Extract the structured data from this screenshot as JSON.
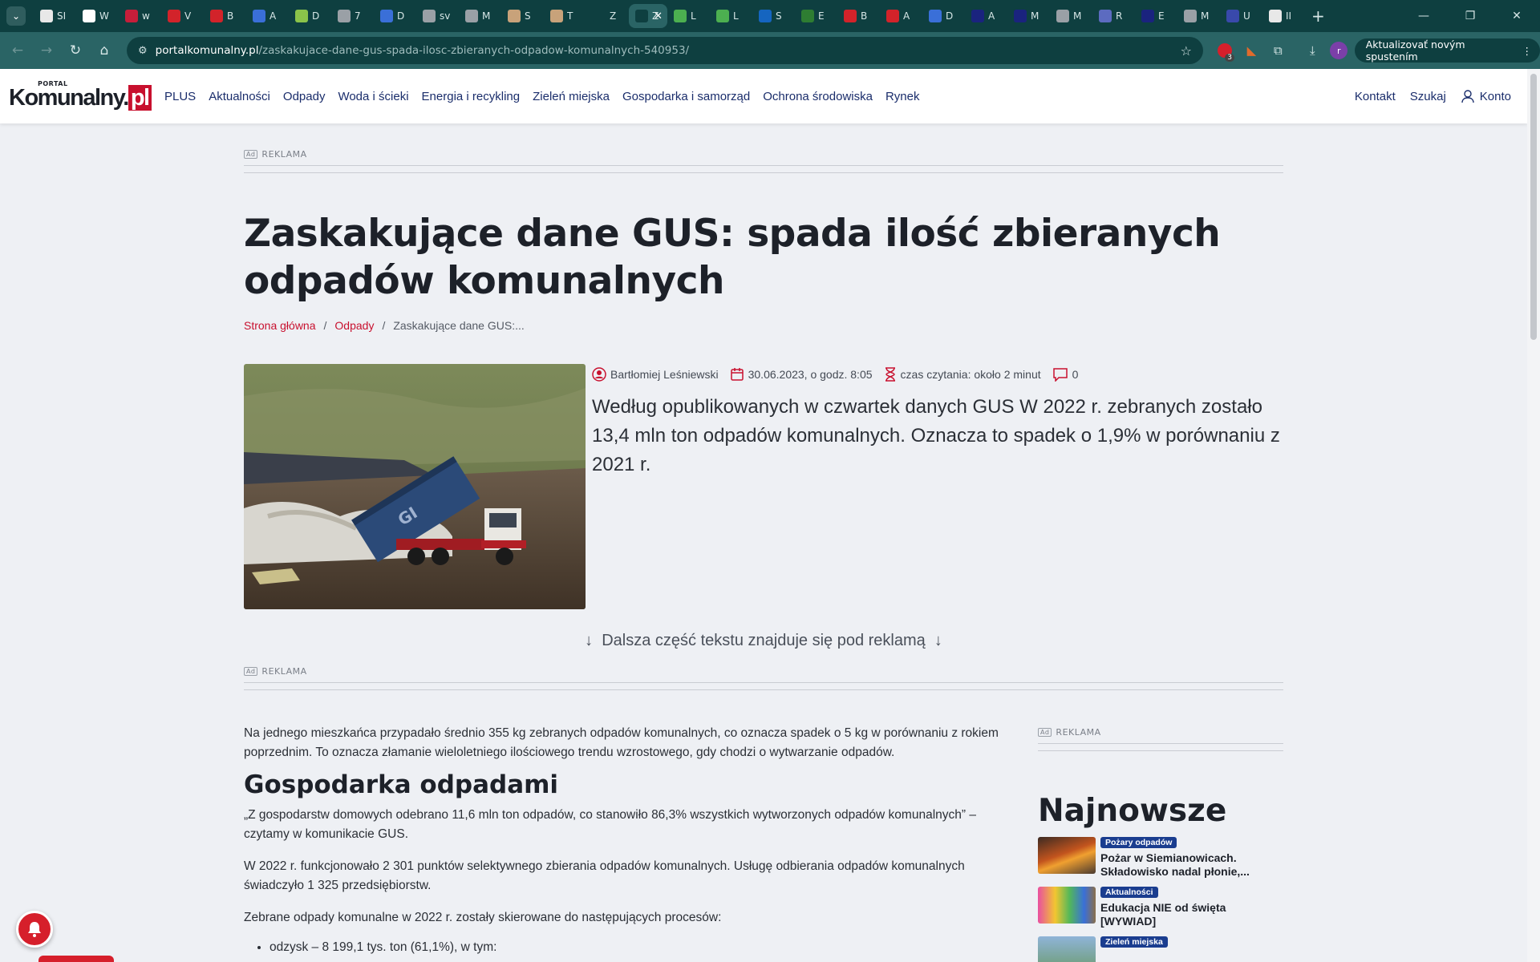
{
  "browser": {
    "tabs": [
      {
        "title": "SI",
        "color": "#e8e8e8"
      },
      {
        "title": "W",
        "color": "#ffffff"
      },
      {
        "title": "w",
        "color": "#c61e3a"
      },
      {
        "title": "V",
        "color": "#d2232a"
      },
      {
        "title": "B",
        "color": "#d2232a"
      },
      {
        "title": "A",
        "color": "#3a6fd8"
      },
      {
        "title": "D",
        "color": "#8bc34a"
      },
      {
        "title": "7",
        "color": "#9aa0a6"
      },
      {
        "title": "D",
        "color": "#3a6fd8"
      },
      {
        "title": "sv",
        "color": "#9aa0a6"
      },
      {
        "title": "M",
        "color": "#9aa0a6"
      },
      {
        "title": "S",
        "color": "#c8a27a"
      },
      {
        "title": "T",
        "color": "#c8a27a"
      },
      {
        "title": "Z",
        "color": "#0e3f40"
      },
      {
        "title": "Z",
        "color": "#0e3f40",
        "active": true
      },
      {
        "title": "L",
        "color": "#4caf50"
      },
      {
        "title": "L",
        "color": "#4caf50"
      },
      {
        "title": "S",
        "color": "#1565c0"
      },
      {
        "title": "E",
        "color": "#2e7d32"
      },
      {
        "title": "B",
        "color": "#d2232a"
      },
      {
        "title": "A",
        "color": "#d2232a"
      },
      {
        "title": "D",
        "color": "#3a6fd8"
      },
      {
        "title": "A",
        "color": "#1a237e"
      },
      {
        "title": "M",
        "color": "#1a237e"
      },
      {
        "title": "M",
        "color": "#9aa0a6"
      },
      {
        "title": "R",
        "color": "#5c6bc0"
      },
      {
        "title": "E",
        "color": "#1a237e"
      },
      {
        "title": "M",
        "color": "#9aa0a6"
      },
      {
        "title": "U",
        "color": "#3949ab"
      },
      {
        "title": "II",
        "color": "#e8e8e8"
      }
    ],
    "url_host": "portalkomunalny.pl",
    "url_path": "/zaskakujace-dane-gus-spada-ilosc-zbieranych-odpadow-komunalnych-540953/",
    "extension_badge": "3",
    "profile_letter": "r",
    "update_label": "Aktualizovať novým spustením"
  },
  "site": {
    "logo_small": "PORTAL",
    "logo_main": "Komunalny.",
    "logo_pl": "pl",
    "nav": [
      "PLUS",
      "Aktualności",
      "Odpady",
      "Woda i ścieki",
      "Energia i recykling",
      "Zieleń miejska",
      "Gospodarka i samorząd",
      "Ochrona środowiska",
      "Rynek"
    ],
    "right_nav": {
      "contact": "Kontakt",
      "search": "Szukaj",
      "account": "Konto"
    }
  },
  "article": {
    "ad_label": "REKLAMA",
    "ad_box": "Ad",
    "title": "Zaskakujące dane GUS: spada ilość zbieranych odpadów komunalnych",
    "breadcrumb": [
      "Strona główna",
      "Odpady",
      "Zaskakujące dane GUS:..."
    ],
    "author": "Bartłomiej Leśniewski",
    "date": "30.06.2023, o godz. 8:05",
    "reading_time": "czas czytania: około 2 minut",
    "comments": "0",
    "lead": "Według opublikowanych w czwartek danych GUS W 2022 r. zebranych zostało 13,4 mln ton odpadów komunalnych. Oznacza to spadek o 1,9% w porównaniu z 2021 r.",
    "continue_note": "Dalsza część tekstu znajduje się pod reklamą",
    "p1": "Na jednego mieszkańca przypadało średnio 355 kg zebranych odpadów komunalnych, co oznacza spadek o 5 kg w porównaniu z rokiem poprzednim. To oznacza złamanie wieloletniego ilościowego trendu wzrostowego, gdy chodzi o wytwarzanie odpadów.",
    "h2": "Gospodarka odpadami",
    "p2": "„Z gospodarstw domowych odebrano 11,6 mln ton odpadów, co stanowiło 86,3% wszystkich wytworzonych odpadów komunalnych” – czytamy w komunikacie GUS.",
    "p3": "W 2022 r. funkcjonowało 2 301 punktów selektywnego zbierania odpadów komunalnych. Usługę odbierania odpadów komunalnych świadczyło 1 325 przedsiębiorstw.",
    "p4": "Zebrane odpady komunalne w 2022 r. zostały skierowane do następujących procesów:",
    "list_item_1": "odzysk – 8 199,1 tys. ton (61,1%), w tym:"
  },
  "sidebar": {
    "ad_label": "REKLAMA",
    "heading": "Najnowsze",
    "news": [
      {
        "tag": "Pożary odpadów",
        "title": "Pożar w Siemianowicach. Składowisko nadal płonie,..."
      },
      {
        "tag": "Aktualności",
        "title": "Edukacja NIE od święta [WYWIAD]"
      },
      {
        "tag": "Zieleń miejska",
        "title": ""
      }
    ]
  }
}
